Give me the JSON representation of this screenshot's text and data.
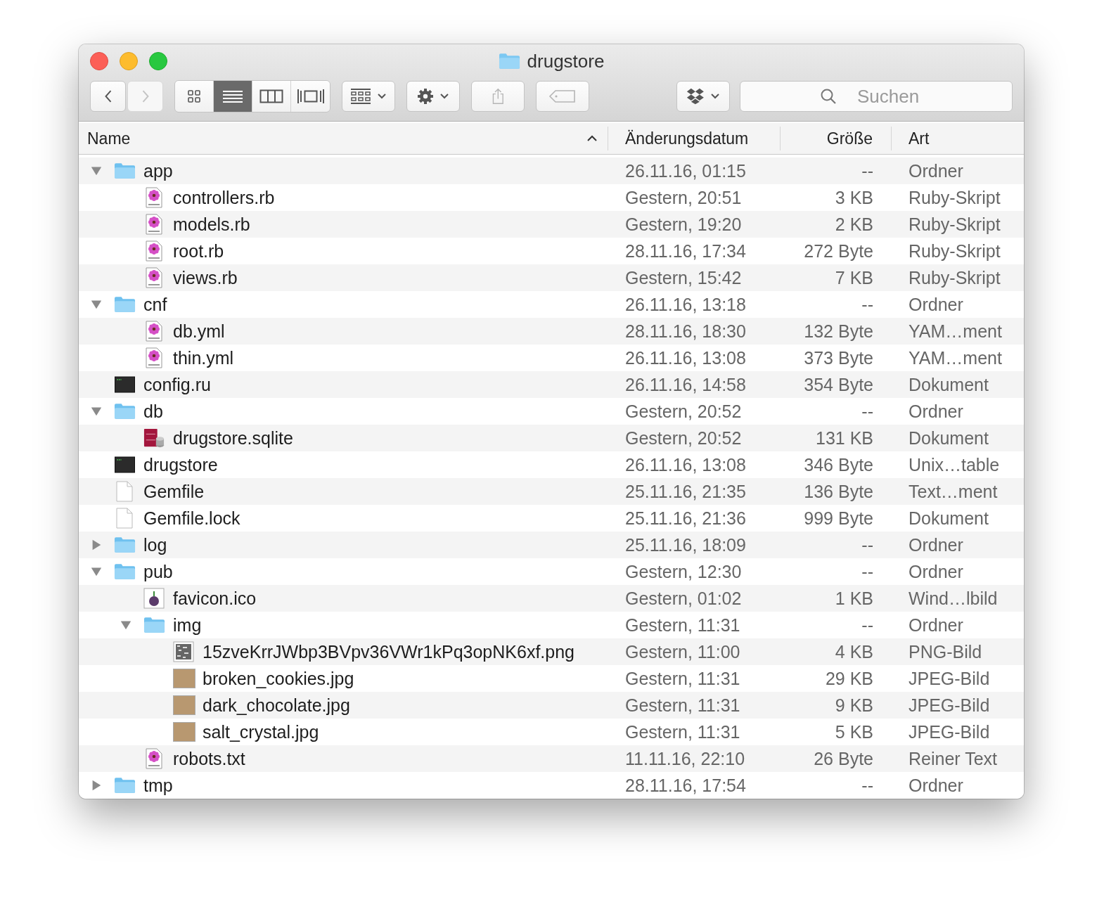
{
  "window": {
    "title": "drugstore"
  },
  "toolbar": {
    "nav": [
      {
        "disabled": false
      },
      {
        "disabled": true
      }
    ],
    "views": [
      {
        "kind": "icons",
        "selected": false
      },
      {
        "kind": "list",
        "selected": true
      },
      {
        "kind": "columns",
        "selected": false
      },
      {
        "kind": "coverflow",
        "selected": false
      }
    ],
    "search": {
      "placeholder": "Suchen"
    }
  },
  "columns": [
    {
      "label": "Name",
      "sorted": true
    },
    {
      "label": "Änderungsdatum",
      "sorted": false
    },
    {
      "label": "Größe",
      "sorted": false
    },
    {
      "label": "Art",
      "sorted": false
    }
  ],
  "rows": [
    {
      "name": "app",
      "date": "26.11.16, 01:15",
      "size": "--",
      "type": "Ordner",
      "kind": "folder",
      "expanded": true,
      "children": [
        {
          "name": "controllers.rb",
          "date": "Gestern, 20:51",
          "size": "3 KB",
          "type": "Ruby-Skript",
          "kind": "script"
        },
        {
          "name": "models.rb",
          "date": "Gestern, 19:20",
          "size": "2 KB",
          "type": "Ruby-Skript",
          "kind": "script"
        },
        {
          "name": "root.rb",
          "date": "28.11.16, 17:34",
          "size": "272 Byte",
          "type": "Ruby-Skript",
          "kind": "script"
        },
        {
          "name": "views.rb",
          "date": "Gestern, 15:42",
          "size": "7 KB",
          "type": "Ruby-Skript",
          "kind": "script"
        }
      ]
    },
    {
      "name": "cnf",
      "date": "26.11.16, 13:18",
      "size": "--",
      "type": "Ordner",
      "kind": "folder",
      "expanded": true,
      "children": [
        {
          "name": "db.yml",
          "date": "28.11.16, 18:30",
          "size": "132 Byte",
          "type": "YAM…ment",
          "kind": "script"
        },
        {
          "name": "thin.yml",
          "date": "26.11.16, 13:08",
          "size": "373 Byte",
          "type": "YAM…ment",
          "kind": "script"
        }
      ]
    },
    {
      "name": "config.ru",
      "date": "26.11.16, 14:58",
      "size": "354 Byte",
      "type": "Dokument",
      "kind": "terminal"
    },
    {
      "name": "db",
      "date": "Gestern, 20:52",
      "size": "--",
      "type": "Ordner",
      "kind": "folder",
      "expanded": true,
      "children": [
        {
          "name": "drugstore.sqlite",
          "date": "Gestern, 20:52",
          "size": "131 KB",
          "type": "Dokument",
          "kind": "database"
        }
      ]
    },
    {
      "name": "drugstore",
      "date": "26.11.16, 13:08",
      "size": "346 Byte",
      "type": "Unix…table",
      "kind": "terminal"
    },
    {
      "name": "Gemfile",
      "date": "25.11.16, 21:35",
      "size": "136 Byte",
      "type": "Text…ment",
      "kind": "document"
    },
    {
      "name": "Gemfile.lock",
      "date": "25.11.16, 21:36",
      "size": "999 Byte",
      "type": "Dokument",
      "kind": "document"
    },
    {
      "name": "log",
      "date": "25.11.16, 18:09",
      "size": "--",
      "type": "Ordner",
      "kind": "folder",
      "expanded": false
    },
    {
      "name": "pub",
      "date": "Gestern, 12:30",
      "size": "--",
      "type": "Ordner",
      "kind": "folder",
      "expanded": true,
      "children": [
        {
          "name": "favicon.ico",
          "date": "Gestern, 01:02",
          "size": "1 KB",
          "type": "Wind…lbild",
          "kind": "favicon"
        },
        {
          "name": "img",
          "date": "Gestern, 11:31",
          "size": "--",
          "type": "Ordner",
          "kind": "folder",
          "expanded": true,
          "children": [
            {
              "name": "15zveKrrJWbp3BVpv36VWr1kPq3opNK6xf.png",
              "date": "Gestern, 11:00",
              "size": "4 KB",
              "type": "PNG-Bild",
              "kind": "pattern"
            },
            {
              "name": "broken_cookies.jpg",
              "date": "Gestern, 11:31",
              "size": "29 KB",
              "type": "JPEG-Bild",
              "kind": "photo"
            },
            {
              "name": "dark_chocolate.jpg",
              "date": "Gestern, 11:31",
              "size": "9 KB",
              "type": "JPEG-Bild",
              "kind": "photo"
            },
            {
              "name": "salt_crystal.jpg",
              "date": "Gestern, 11:31",
              "size": "5 KB",
              "type": "JPEG-Bild",
              "kind": "photo"
            }
          ]
        },
        {
          "name": "robots.txt",
          "date": "11.11.16, 22:10",
          "size": "26 Byte",
          "type": "Reiner Text",
          "kind": "script"
        }
      ]
    },
    {
      "name": "tmp",
      "date": "28.11.16, 17:54",
      "size": "--",
      "type": "Ordner",
      "kind": "folder",
      "expanded": false
    }
  ]
}
